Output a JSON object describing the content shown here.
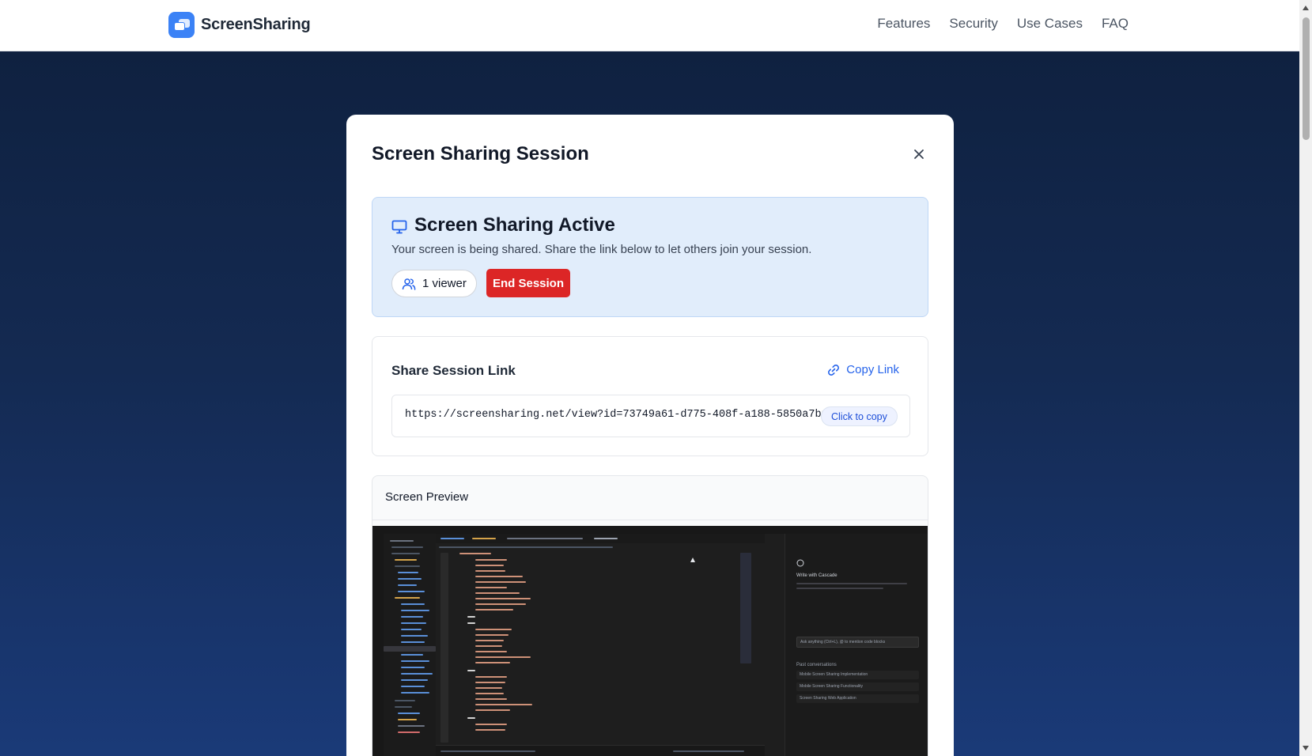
{
  "brand": {
    "name": "ScreenSharing",
    "logo_icon": "screens-logo-icon",
    "accent": "#3b82f6"
  },
  "nav": {
    "links": [
      "Features",
      "Security",
      "Use Cases",
      "FAQ"
    ]
  },
  "modal": {
    "title": "Screen Sharing Session",
    "close_icon": "close-icon",
    "active": {
      "icon": "monitor-icon",
      "title": "Screen Sharing Active",
      "description": "Your screen is being shared. Share the link below to let others join your session.",
      "viewers_icon": "users-icon",
      "viewers_label": "1 viewer",
      "end_label": "End Session",
      "end_color": "#dc2626"
    },
    "share": {
      "title": "Share Session Link",
      "copy_icon": "link-icon",
      "copy_label": "Copy Link",
      "url": "https://screensharing.net/view?id=73749a61-d775-408f-a188-5850a7b2d6",
      "click_to_copy": "Click to copy"
    },
    "preview": {
      "title": "Screen Preview",
      "chat_heading": "Write with Cascade",
      "chat_input_placeholder": "Ask anything (Ctrl+L), @ to mention code blocks",
      "chat_recent_label": "Past conversations",
      "chat_items": [
        "Mobile Screen Sharing Implementation",
        "Mobile Screen Sharing Functionality",
        "Screen Sharing Web Application"
      ]
    }
  }
}
